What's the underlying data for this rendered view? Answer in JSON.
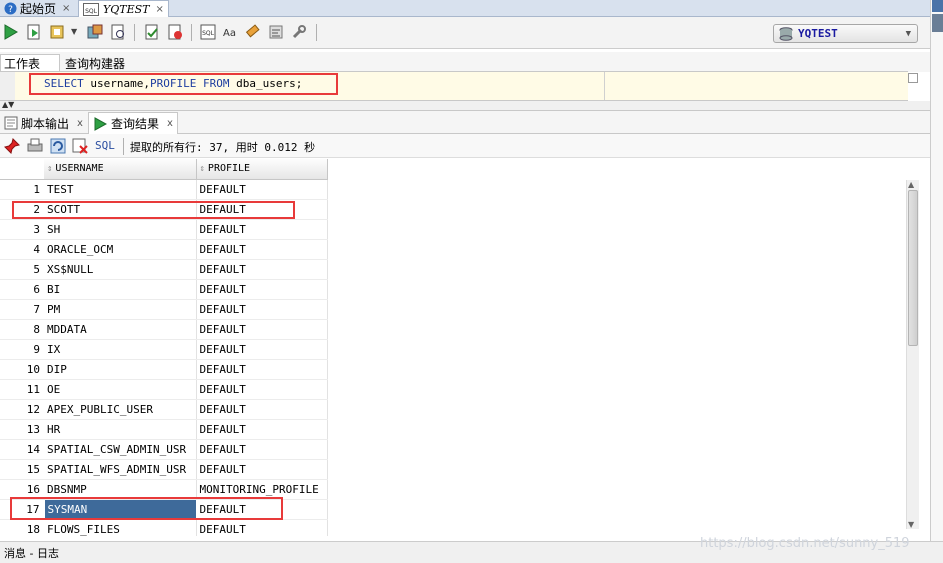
{
  "doc_tabs": [
    {
      "label": "起始页",
      "close": "×"
    },
    {
      "label": "YQTEST",
      "close": "×"
    }
  ],
  "connection": {
    "name": "YQTEST"
  },
  "editor_tabs": [
    {
      "label": "工作表"
    },
    {
      "label": "查询构建器"
    }
  ],
  "sql": {
    "kw1": "SELECT",
    "t1": " username,",
    "kw2": "PROFILE",
    "t2": " ",
    "kw3": "FROM",
    "t3": " dba_users;"
  },
  "output_tabs": [
    {
      "label": "脚本输出",
      "close": "x"
    },
    {
      "label": "查询结果",
      "close": "x"
    }
  ],
  "results_toolbar": {
    "sql_label": "SQL",
    "status": "提取的所有行: 37, 用时 0.012 秒"
  },
  "grid": {
    "columns": [
      "USERNAME",
      "PROFILE"
    ],
    "rows": [
      {
        "n": "1",
        "username": "TEST",
        "profile": "DEFAULT"
      },
      {
        "n": "2",
        "username": "SCOTT",
        "profile": "DEFAULT"
      },
      {
        "n": "3",
        "username": "SH",
        "profile": "DEFAULT"
      },
      {
        "n": "4",
        "username": "ORACLE_OCM",
        "profile": "DEFAULT"
      },
      {
        "n": "5",
        "username": "XS$NULL",
        "profile": "DEFAULT"
      },
      {
        "n": "6",
        "username": "BI",
        "profile": "DEFAULT"
      },
      {
        "n": "7",
        "username": "PM",
        "profile": "DEFAULT"
      },
      {
        "n": "8",
        "username": "MDDATA",
        "profile": "DEFAULT"
      },
      {
        "n": "9",
        "username": "IX",
        "profile": "DEFAULT"
      },
      {
        "n": "10",
        "username": "DIP",
        "profile": "DEFAULT"
      },
      {
        "n": "11",
        "username": "OE",
        "profile": "DEFAULT"
      },
      {
        "n": "12",
        "username": "APEX_PUBLIC_USER",
        "profile": "DEFAULT"
      },
      {
        "n": "13",
        "username": "HR",
        "profile": "DEFAULT"
      },
      {
        "n": "14",
        "username": "SPATIAL_CSW_ADMIN_USR",
        "profile": "DEFAULT"
      },
      {
        "n": "15",
        "username": "SPATIAL_WFS_ADMIN_USR",
        "profile": "DEFAULT"
      },
      {
        "n": "16",
        "username": "DBSNMP",
        "profile": "MONITORING_PROFILE"
      },
      {
        "n": "17",
        "username": "SYSMAN",
        "profile": "DEFAULT"
      },
      {
        "n": "18",
        "username": "FLOWS_FILES",
        "profile": "DEFAULT"
      }
    ],
    "selected_row": "17"
  },
  "statusbar": {
    "label": "消息 - 日志"
  },
  "watermark": "https://blog.csdn.net/sunny_519",
  "colors": {
    "selection": "#3e6a9a",
    "highlight_box": "#e83a3a",
    "keyword": "#1e3ea0",
    "editor_bg": "#fffbe6"
  },
  "icons": [
    "help-icon",
    "sql-file-icon",
    "run-statement-icon",
    "run-script-icon",
    "autotrace-icon",
    "explain-plan-icon",
    "commit-icon",
    "rollback-icon",
    "sql-tuning-icon",
    "uppercase-icon",
    "clear-icon",
    "sql-history-icon",
    "pin-icon",
    "print-icon",
    "refresh-icon",
    "delete-icon"
  ]
}
